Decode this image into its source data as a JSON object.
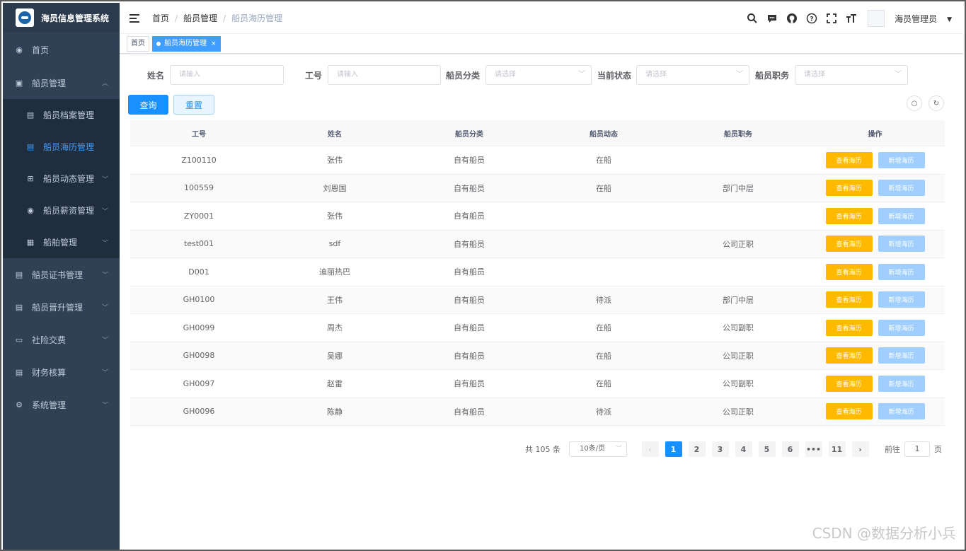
{
  "app": {
    "title": "海员信息管理系统"
  },
  "sidebar": {
    "items": [
      {
        "label": "首页",
        "icon": "dashboard-icon"
      },
      {
        "label": "船员管理",
        "icon": "copy-icon",
        "expanded": true
      },
      {
        "label": "船员证书管理",
        "icon": "document-icon"
      },
      {
        "label": "船员晋升管理",
        "icon": "document-icon"
      },
      {
        "label": "社险交费",
        "icon": "grid-icon"
      },
      {
        "label": "财务核算",
        "icon": "document-icon"
      },
      {
        "label": "系统管理",
        "icon": "gear-icon"
      }
    ],
    "sub": [
      {
        "label": "船员档案管理",
        "icon": "document-icon"
      },
      {
        "label": "船员海历管理",
        "icon": "document-icon",
        "active": true
      },
      {
        "label": "船员动态管理",
        "icon": "table-icon"
      },
      {
        "label": "船员薪资管理",
        "icon": "dashboard-icon"
      },
      {
        "label": "船舶管理",
        "icon": "server-icon"
      }
    ]
  },
  "navbar": {
    "breadcrumb": [
      "首页",
      "船员管理",
      "船员海历管理"
    ],
    "username": "海员管理员"
  },
  "tags": {
    "home": "首页",
    "active": "船员海历管理"
  },
  "search": {
    "name_label": "姓名",
    "name_placeholder": "请输入",
    "id_label": "工号",
    "id_placeholder": "请输入",
    "category_label": "船员分类",
    "category_placeholder": "请选择",
    "status_label": "当前状态",
    "status_placeholder": "请选择",
    "position_label": "船员职务",
    "position_placeholder": "请选择",
    "query_button": "查询",
    "reset_button": "重置"
  },
  "table": {
    "headers": [
      "工号",
      "姓名",
      "船员分类",
      "船员动态",
      "船员职务",
      "操作"
    ],
    "view_label": "查看海历",
    "add_label": "新增海历",
    "rows": [
      [
        "Z100110",
        "张伟",
        "自有船员",
        "在船",
        ""
      ],
      [
        "100559",
        "刘恩国",
        "自有船员",
        "在船",
        "部门中层"
      ],
      [
        "ZY0001",
        "张伟",
        "自有船员",
        "",
        ""
      ],
      [
        "test001",
        "sdf",
        "自有船员",
        "",
        "公司正职"
      ],
      [
        "D001",
        "迪丽热巴",
        "自有船员",
        "",
        ""
      ],
      [
        "GH0100",
        "王伟",
        "自有船员",
        "待派",
        "部门中层"
      ],
      [
        "GH0099",
        "周杰",
        "自有船员",
        "在船",
        "公司副职"
      ],
      [
        "GH0098",
        "吴娜",
        "自有船员",
        "在船",
        "公司正职"
      ],
      [
        "GH0097",
        "赵雷",
        "自有船员",
        "在船",
        "公司副职"
      ],
      [
        "GH0096",
        "陈静",
        "自有船员",
        "待派",
        "公司正职"
      ]
    ]
  },
  "pagination": {
    "total": "共 105 条",
    "page_size": "10条/页",
    "pages": [
      "1",
      "2",
      "3",
      "4",
      "5",
      "6",
      "•••",
      "11"
    ],
    "current": "1",
    "goto_prefix": "前往",
    "goto_value": "1",
    "goto_suffix": "页"
  },
  "watermark": "CSDN @数据分析小兵",
  "colors": {
    "sidebar": "#304156",
    "primary": "#1890ff",
    "warning": "#ffba00"
  }
}
